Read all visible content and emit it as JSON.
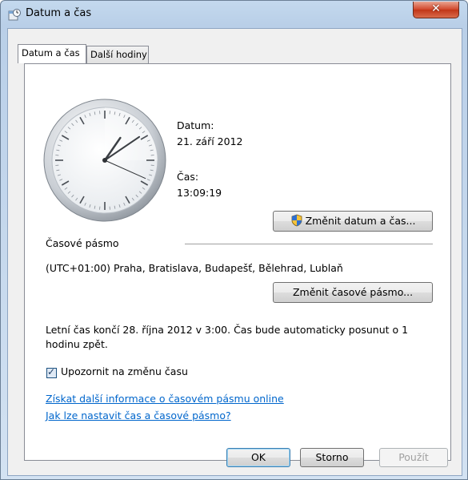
{
  "window": {
    "title": "Datum a čas"
  },
  "tabs": [
    {
      "label": "Datum a čas",
      "active": true
    },
    {
      "label": "Další hodiny",
      "active": false
    }
  ],
  "clock": {
    "hours": 13,
    "minutes": 9,
    "seconds": 19
  },
  "date": {
    "label": "Datum:",
    "value": "21. září 2012"
  },
  "time": {
    "label": "Čas:",
    "value": "13:09:19"
  },
  "buttons": {
    "change_datetime": "Změnit datum a čas...",
    "change_timezone": "Změnit časové pásmo...",
    "ok": "OK",
    "cancel": "Storno",
    "apply": "Použít"
  },
  "timezone": {
    "heading": "Časové pásmo",
    "value": "(UTC+01:00) Praha, Bratislava, Budapešť, Bělehrad, Lublaň"
  },
  "dst": {
    "line1": "Letní čas končí 28. října 2012 v 3:00. Čas bude automaticky posunut o 1",
    "line2": "hodinu zpět."
  },
  "notify_checkbox": {
    "label": "Upozornit na změnu času",
    "checked": true
  },
  "links": {
    "more_info": "Získat další informace o časovém pásmu online",
    "how_to": "Jak lze nastavit čas a časové pásmo?"
  },
  "icons": {
    "title": "date-time-control-panel-icon",
    "shield": "uac-shield-icon",
    "close": "close-icon"
  },
  "colors": {
    "link": "#0066cc",
    "close_button": "#c13517",
    "title_bar": "#b9cfe8"
  }
}
